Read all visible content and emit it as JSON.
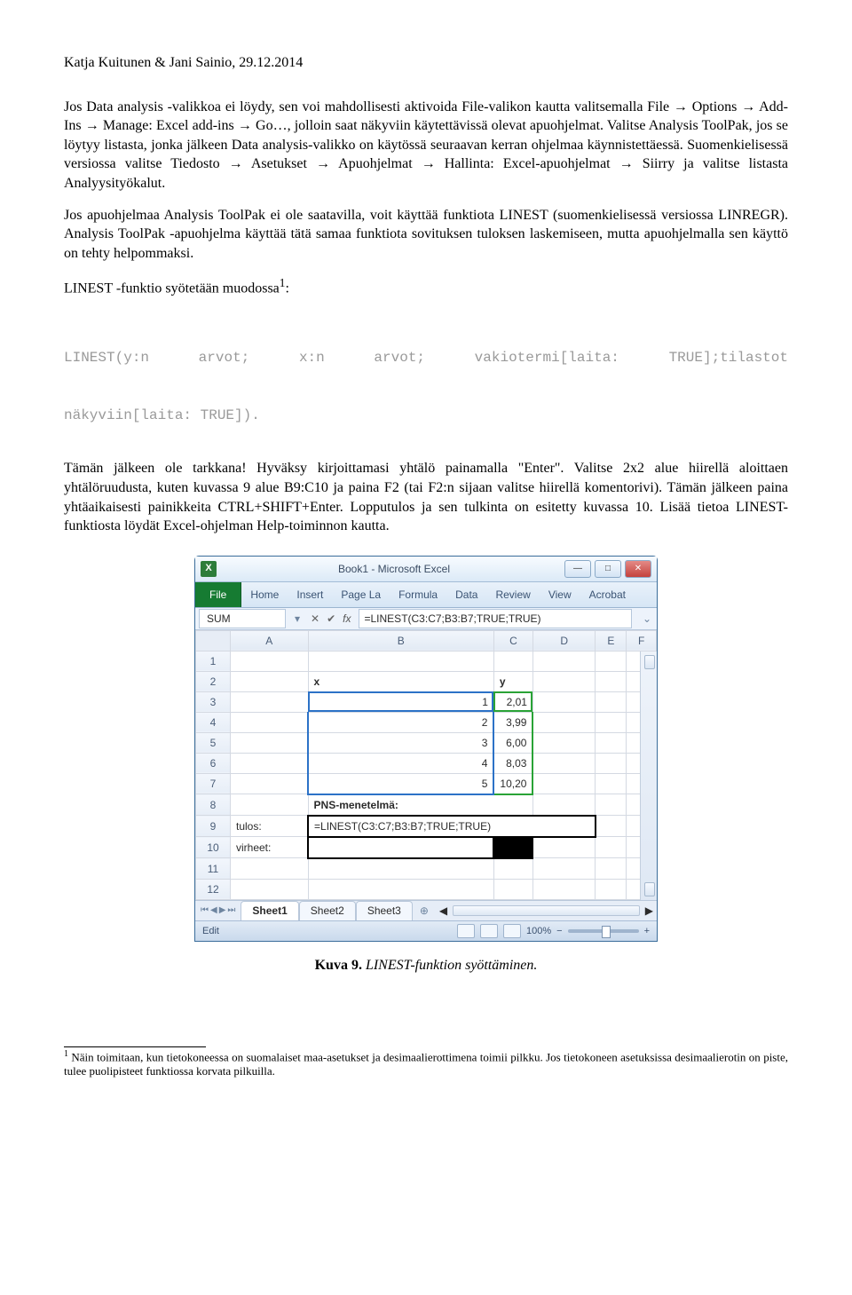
{
  "header": "Katja Kuitunen & Jani Sainio, 29.12.2014",
  "p1": "Jos Data analysis -valikkoa ei löydy, sen voi mahdollisesti aktivoida File-valikon kautta valitsemalla File → Options → Add-Ins → Manage: Excel add-ins → Go…, jolloin saat näkyviin käytettävissä olevat apuohjelmat. Valitse Analysis ToolPak, jos se löytyy listasta, jonka jälkeen Data analysis-valikko on käytössä seuraavan kerran ohjelmaa käynnistettäessä. Suomenkielisessä versiossa valitse Tiedosto → Asetukset → Apuohjelmat → Hallinta: Excel-apuohjelmat → Siirry ja valitse listasta Analyysityökalut.",
  "p2": "Jos apuohjelmaa Analysis ToolPak ei ole saatavilla, voit käyttää funktiota LINEST (suomenkielisessä versiossa LINREGR). Analysis ToolPak -apuohjelma käyttää tätä samaa funktiota sovituksen tuloksen laskemiseen, mutta apuohjelmalla sen käyttö on tehty helpommaksi.",
  "p3_prefix": "LINEST -funktio syötetään muodossa",
  "p3_suffix": ":",
  "code": {
    "l1a": "LINEST(y:n",
    "l1b": "arvot;",
    "l1c": "x:n",
    "l1d": "arvot;",
    "l1e": "vakiotermi[laita:",
    "l1f": "TRUE];tilastot",
    "l2": "näkyviin[laita: TRUE])."
  },
  "p4": "Tämän jälkeen ole tarkkana! Hyväksy kirjoittamasi yhtälö painamalla \"Enter\". Valitse 2x2 alue hiirellä aloittaen yhtälöruudusta, kuten kuvassa 9 alue B9:C10 ja paina F2 (tai F2:n sijaan valitse hiirellä komentorivi). Tämän jälkeen paina yhtäaikaisesti painikkeita CTRL+SHIFT+Enter. Lopputulos ja sen tulkinta on esitetty kuvassa 10. Lisää tietoa LINEST-funktiosta löydät Excel-ohjelman Help-toiminnon kautta.",
  "caption_b": "Kuva 9.",
  "caption_i": "LINEST-funktion syöttäminen.",
  "footnote": "Näin toimitaan, kun tietokoneessa on suomalaiset maa-asetukset ja desimaalierottimena toimii pilkku. Jos tietokoneen asetuksissa desimaalierotin on piste, tulee puolipisteet funktiossa korvata pilkuilla.",
  "excel": {
    "title": "Book1 - Microsoft Excel",
    "file": "File",
    "tabs": [
      "Home",
      "Insert",
      "Page La",
      "Formula",
      "Data",
      "Review",
      "View",
      "Acrobat"
    ],
    "namebox": "SUM",
    "formula": "=LINEST(C3:C7;B3:B7;TRUE;TRUE)",
    "cols": [
      "A",
      "B",
      "C",
      "D",
      "E",
      "F"
    ],
    "rows": {
      "2": {
        "B": "x",
        "C": "y"
      },
      "3": {
        "B": "1",
        "C": "2,01"
      },
      "4": {
        "B": "2",
        "C": "3,99"
      },
      "5": {
        "B": "3",
        "C": "6,00"
      },
      "6": {
        "B": "4",
        "C": "8,03"
      },
      "7": {
        "B": "5",
        "C": "10,20"
      },
      "8": {
        "A": "",
        "B": "PNS-menetelmä:"
      },
      "9": {
        "A": "tulos:",
        "B": "=LINEST(C3:C7;B3:B7;TRUE;TRUE)"
      },
      "10": {
        "A": "virheet:"
      }
    },
    "sheets": [
      "Sheet1",
      "Sheet2",
      "Sheet3"
    ],
    "status": "Edit",
    "zoom": "100%"
  }
}
